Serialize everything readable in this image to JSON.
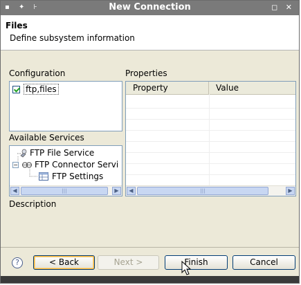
{
  "window": {
    "title": "New Connection",
    "titlebar_icons": "▪ ✦ ⊦",
    "window_buttons": "◻ ✕"
  },
  "header": {
    "title": "Files",
    "description": "Define subsystem information"
  },
  "configuration": {
    "label": "Configuration",
    "items": [
      {
        "label": "ftp,files",
        "checked": true
      }
    ]
  },
  "services": {
    "label": "Available Services",
    "tree": [
      {
        "label": "FTP File Service",
        "icon": "service-icon"
      },
      {
        "label": "FTP Connector Servi",
        "icon": "connector-icon",
        "expanded": true
      },
      {
        "label": "FTP Settings",
        "icon": "table-icon"
      }
    ]
  },
  "properties": {
    "label": "Properties",
    "columns": [
      "Property",
      "Value"
    ]
  },
  "description": {
    "label": "Description"
  },
  "buttons": {
    "help": "?",
    "back": "< Back",
    "next": "Next >",
    "finish": "Finish",
    "cancel": "Cancel"
  }
}
